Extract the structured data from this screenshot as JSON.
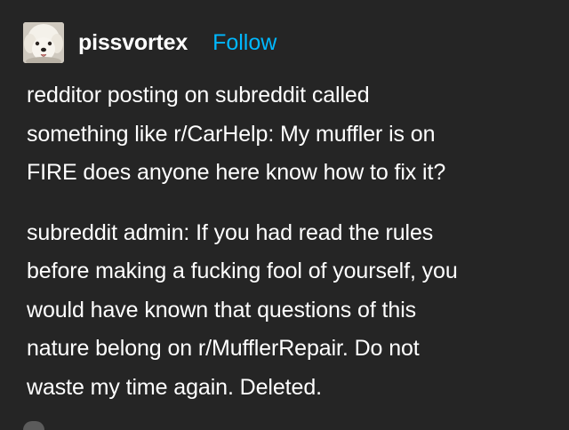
{
  "post": {
    "username": "pissvortex",
    "follow_label": "Follow",
    "accent_color": "#00b8ff",
    "background_color": "#252525",
    "avatar_icon": "dog-avatar-icon",
    "paragraphs": [
      "redditor posting on subreddit called\nsomething like r/CarHelp: My muffler is on\nFIRE does anyone here know how to fix it?",
      "subreddit admin: If you had read the rules\nbefore making a fucking fool of yourself, you\nwould have known that questions of this\nnature belong on r/MufflerRepair. Do not\nwaste my time again. Deleted."
    ]
  }
}
